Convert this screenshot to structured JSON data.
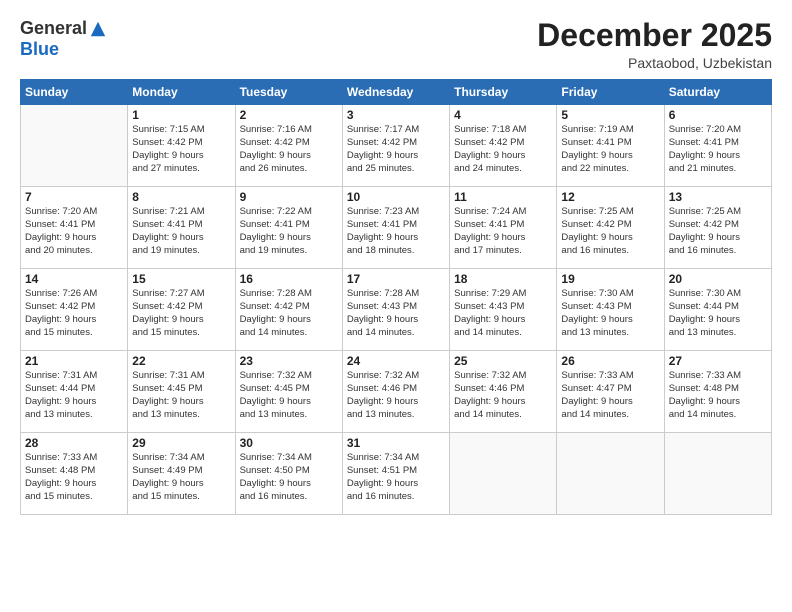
{
  "logo": {
    "general": "General",
    "blue": "Blue"
  },
  "header": {
    "month": "December 2025",
    "location": "Paxtaobod, Uzbekistan"
  },
  "weekdays": [
    "Sunday",
    "Monday",
    "Tuesday",
    "Wednesday",
    "Thursday",
    "Friday",
    "Saturday"
  ],
  "weeks": [
    [
      {
        "day": "",
        "info": ""
      },
      {
        "day": "1",
        "info": "Sunrise: 7:15 AM\nSunset: 4:42 PM\nDaylight: 9 hours\nand 27 minutes."
      },
      {
        "day": "2",
        "info": "Sunrise: 7:16 AM\nSunset: 4:42 PM\nDaylight: 9 hours\nand 26 minutes."
      },
      {
        "day": "3",
        "info": "Sunrise: 7:17 AM\nSunset: 4:42 PM\nDaylight: 9 hours\nand 25 minutes."
      },
      {
        "day": "4",
        "info": "Sunrise: 7:18 AM\nSunset: 4:42 PM\nDaylight: 9 hours\nand 24 minutes."
      },
      {
        "day": "5",
        "info": "Sunrise: 7:19 AM\nSunset: 4:41 PM\nDaylight: 9 hours\nand 22 minutes."
      },
      {
        "day": "6",
        "info": "Sunrise: 7:20 AM\nSunset: 4:41 PM\nDaylight: 9 hours\nand 21 minutes."
      }
    ],
    [
      {
        "day": "7",
        "info": "Sunrise: 7:20 AM\nSunset: 4:41 PM\nDaylight: 9 hours\nand 20 minutes."
      },
      {
        "day": "8",
        "info": "Sunrise: 7:21 AM\nSunset: 4:41 PM\nDaylight: 9 hours\nand 19 minutes."
      },
      {
        "day": "9",
        "info": "Sunrise: 7:22 AM\nSunset: 4:41 PM\nDaylight: 9 hours\nand 19 minutes."
      },
      {
        "day": "10",
        "info": "Sunrise: 7:23 AM\nSunset: 4:41 PM\nDaylight: 9 hours\nand 18 minutes."
      },
      {
        "day": "11",
        "info": "Sunrise: 7:24 AM\nSunset: 4:41 PM\nDaylight: 9 hours\nand 17 minutes."
      },
      {
        "day": "12",
        "info": "Sunrise: 7:25 AM\nSunset: 4:42 PM\nDaylight: 9 hours\nand 16 minutes."
      },
      {
        "day": "13",
        "info": "Sunrise: 7:25 AM\nSunset: 4:42 PM\nDaylight: 9 hours\nand 16 minutes."
      }
    ],
    [
      {
        "day": "14",
        "info": "Sunrise: 7:26 AM\nSunset: 4:42 PM\nDaylight: 9 hours\nand 15 minutes."
      },
      {
        "day": "15",
        "info": "Sunrise: 7:27 AM\nSunset: 4:42 PM\nDaylight: 9 hours\nand 15 minutes."
      },
      {
        "day": "16",
        "info": "Sunrise: 7:28 AM\nSunset: 4:42 PM\nDaylight: 9 hours\nand 14 minutes."
      },
      {
        "day": "17",
        "info": "Sunrise: 7:28 AM\nSunset: 4:43 PM\nDaylight: 9 hours\nand 14 minutes."
      },
      {
        "day": "18",
        "info": "Sunrise: 7:29 AM\nSunset: 4:43 PM\nDaylight: 9 hours\nand 14 minutes."
      },
      {
        "day": "19",
        "info": "Sunrise: 7:30 AM\nSunset: 4:43 PM\nDaylight: 9 hours\nand 13 minutes."
      },
      {
        "day": "20",
        "info": "Sunrise: 7:30 AM\nSunset: 4:44 PM\nDaylight: 9 hours\nand 13 minutes."
      }
    ],
    [
      {
        "day": "21",
        "info": "Sunrise: 7:31 AM\nSunset: 4:44 PM\nDaylight: 9 hours\nand 13 minutes."
      },
      {
        "day": "22",
        "info": "Sunrise: 7:31 AM\nSunset: 4:45 PM\nDaylight: 9 hours\nand 13 minutes."
      },
      {
        "day": "23",
        "info": "Sunrise: 7:32 AM\nSunset: 4:45 PM\nDaylight: 9 hours\nand 13 minutes."
      },
      {
        "day": "24",
        "info": "Sunrise: 7:32 AM\nSunset: 4:46 PM\nDaylight: 9 hours\nand 13 minutes."
      },
      {
        "day": "25",
        "info": "Sunrise: 7:32 AM\nSunset: 4:46 PM\nDaylight: 9 hours\nand 14 minutes."
      },
      {
        "day": "26",
        "info": "Sunrise: 7:33 AM\nSunset: 4:47 PM\nDaylight: 9 hours\nand 14 minutes."
      },
      {
        "day": "27",
        "info": "Sunrise: 7:33 AM\nSunset: 4:48 PM\nDaylight: 9 hours\nand 14 minutes."
      }
    ],
    [
      {
        "day": "28",
        "info": "Sunrise: 7:33 AM\nSunset: 4:48 PM\nDaylight: 9 hours\nand 15 minutes."
      },
      {
        "day": "29",
        "info": "Sunrise: 7:34 AM\nSunset: 4:49 PM\nDaylight: 9 hours\nand 15 minutes."
      },
      {
        "day": "30",
        "info": "Sunrise: 7:34 AM\nSunset: 4:50 PM\nDaylight: 9 hours\nand 16 minutes."
      },
      {
        "day": "31",
        "info": "Sunrise: 7:34 AM\nSunset: 4:51 PM\nDaylight: 9 hours\nand 16 minutes."
      },
      {
        "day": "",
        "info": ""
      },
      {
        "day": "",
        "info": ""
      },
      {
        "day": "",
        "info": ""
      }
    ]
  ]
}
